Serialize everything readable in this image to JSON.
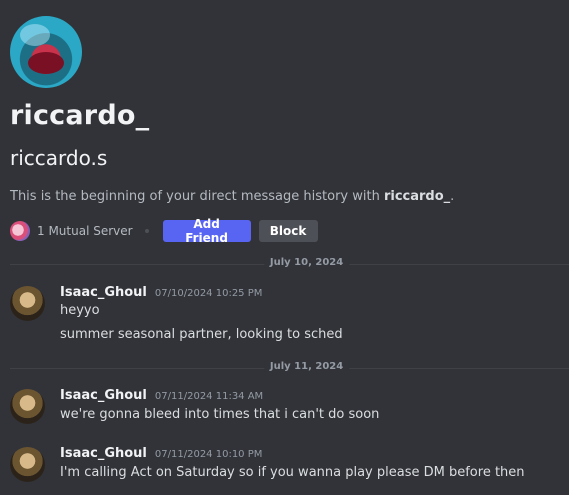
{
  "profile": {
    "display_name": "riccardo_",
    "username": "riccardo.s",
    "intro_prefix": "This is the beginning of your direct message history with ",
    "intro_name": "riccardo_",
    "intro_suffix": ".",
    "mutual_servers": "1 Mutual Server",
    "add_friend_label": "Add Friend",
    "block_label": "Block",
    "accent_color": "#5865f2"
  },
  "dividers": [
    "July 10, 2024",
    "July 11, 2024"
  ],
  "messages": [
    {
      "author": "Isaac_Ghoul",
      "timestamp": "07/10/2024 10:25 PM",
      "lines": [
        "heyyo",
        "summer seasonal partner, looking to sched"
      ]
    },
    {
      "author": "Isaac_Ghoul",
      "timestamp": "07/11/2024 11:34 AM",
      "lines": [
        "we're gonna bleed into times that i can't do soon"
      ]
    },
    {
      "author": "Isaac_Ghoul",
      "timestamp": "07/11/2024 10:10 PM",
      "lines": [
        "I'm calling Act on Saturday so if you wanna play please DM before then"
      ]
    }
  ]
}
